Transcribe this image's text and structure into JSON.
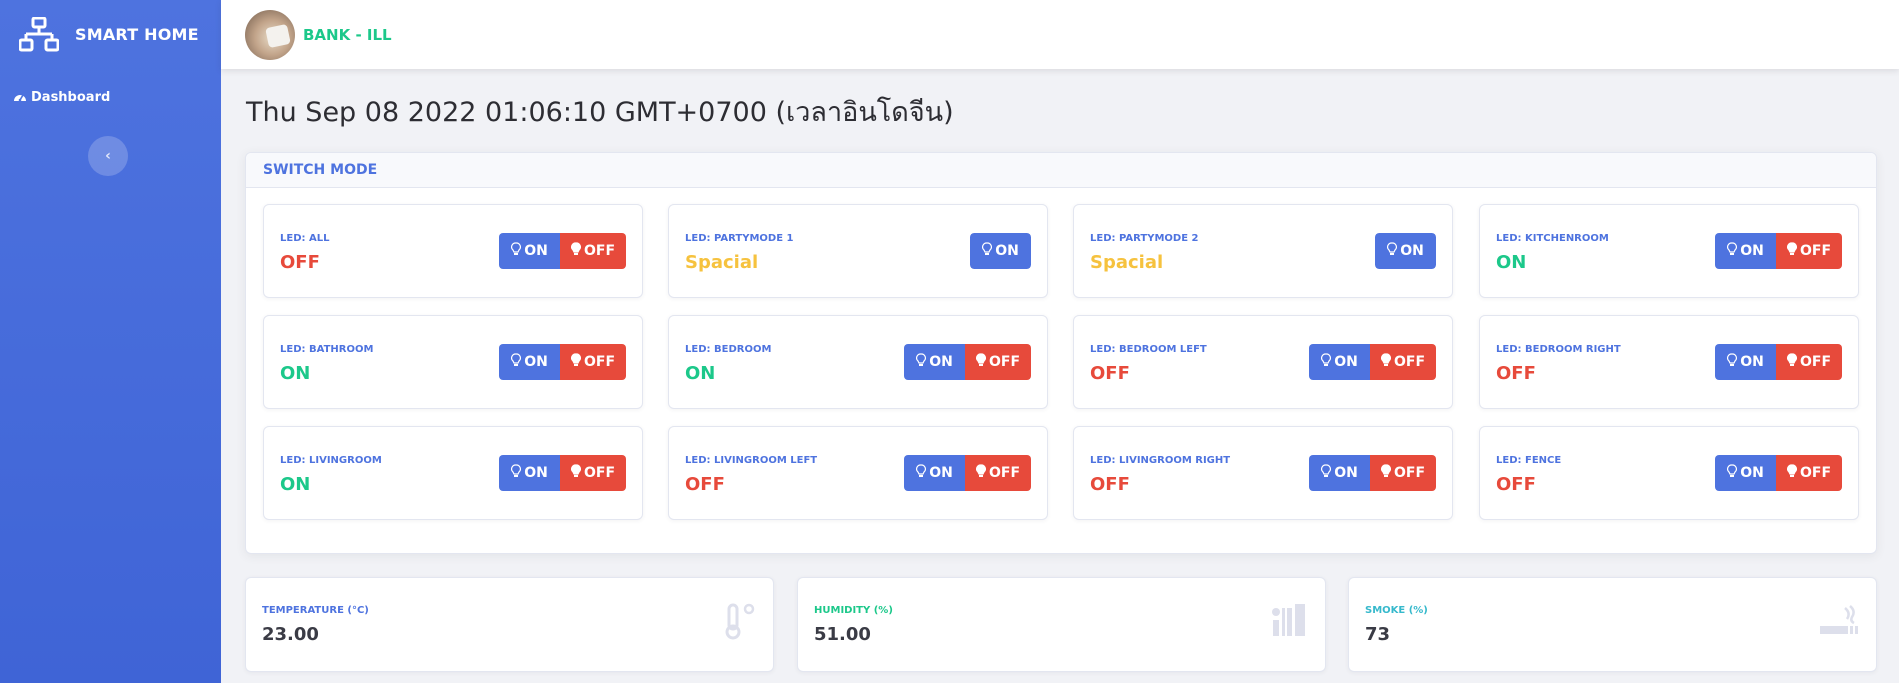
{
  "app": {
    "brand": "SMART HOME",
    "nav_dashboard": "Dashboard",
    "toggle_glyph": "‹"
  },
  "user": {
    "name": "BANK - ILL"
  },
  "datetime": "Thu Sep 08 2022 01:06:10 GMT+0700 (เวลาอินโดจีน)",
  "switch_panel": {
    "title": "SWITCH MODE",
    "on_label": "ON",
    "off_label": "OFF",
    "devices": [
      {
        "label": "LED: ALL",
        "state": "OFF",
        "status": "off",
        "buttons": "both"
      },
      {
        "label": "LED: PARTYMODE 1",
        "state": "Spacial",
        "status": "spacial",
        "buttons": "on"
      },
      {
        "label": "LED: PARTYMODE 2",
        "state": "Spacial",
        "status": "spacial",
        "buttons": "on"
      },
      {
        "label": "LED: KITCHENROOM",
        "state": "ON",
        "status": "on",
        "buttons": "both"
      },
      {
        "label": "LED: BATHROOM",
        "state": "ON",
        "status": "on",
        "buttons": "both"
      },
      {
        "label": "LED: BEDROOM",
        "state": "ON",
        "status": "on",
        "buttons": "both"
      },
      {
        "label": "LED: BEDROOM LEFT",
        "state": "OFF",
        "status": "off",
        "buttons": "both"
      },
      {
        "label": "LED: BEDROOM RIGHT",
        "state": "OFF",
        "status": "off",
        "buttons": "both"
      },
      {
        "label": "LED: LIVINGROOM",
        "state": "ON",
        "status": "on",
        "buttons": "both"
      },
      {
        "label": "LED: LIVINGROOM LEFT",
        "state": "OFF",
        "status": "off",
        "buttons": "both"
      },
      {
        "label": "LED: LIVINGROOM RIGHT",
        "state": "OFF",
        "status": "off",
        "buttons": "both"
      },
      {
        "label": "LED: FENCE",
        "state": "OFF",
        "status": "off",
        "buttons": "both"
      }
    ]
  },
  "sensors": [
    {
      "label": "TEMPERATURE (°C)",
      "value": "23.00",
      "color": "#4e73df",
      "icon": "thermometer-icon"
    },
    {
      "label": "HUMIDITY (%)",
      "value": "51.00",
      "color": "#1cc88a",
      "icon": "shower-icon"
    },
    {
      "label": "SMOKE (%)",
      "value": "73",
      "color": "#36b9cc",
      "icon": "smoking-icon"
    }
  ],
  "colors": {
    "primary": "#4e73df",
    "success": "#1cc88a",
    "danger": "#e74a3b",
    "warning": "#f6c23e",
    "info": "#36b9cc"
  }
}
